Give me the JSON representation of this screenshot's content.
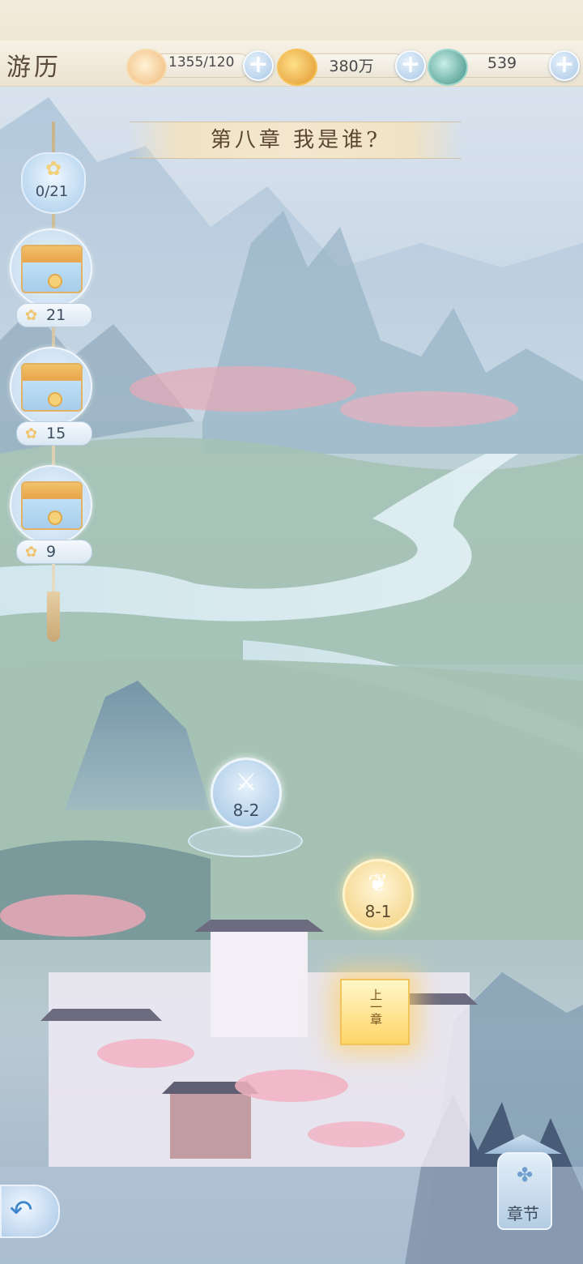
{
  "header": {
    "title": "游历",
    "resources": [
      {
        "icon": "cat-stamina-icon",
        "value": "1355/120"
      },
      {
        "icon": "gold-coin-icon",
        "value": "380万"
      },
      {
        "icon": "jade-dragon-icon",
        "value": "539"
      }
    ],
    "plus_symbol": "+"
  },
  "chapter": {
    "title": "第八章 我是谁?"
  },
  "rewards": {
    "progress": "0/21",
    "chests": [
      {
        "requirement": "21"
      },
      {
        "requirement": "15"
      },
      {
        "requirement": "9"
      }
    ]
  },
  "stages": [
    {
      "label": "8-2",
      "icon": "crossed-swords-icon"
    },
    {
      "label": "8-1",
      "icon": "butterfly-icon"
    }
  ],
  "prev_chapter": {
    "label": "上一章"
  },
  "chapter_button": {
    "label": "章节"
  }
}
